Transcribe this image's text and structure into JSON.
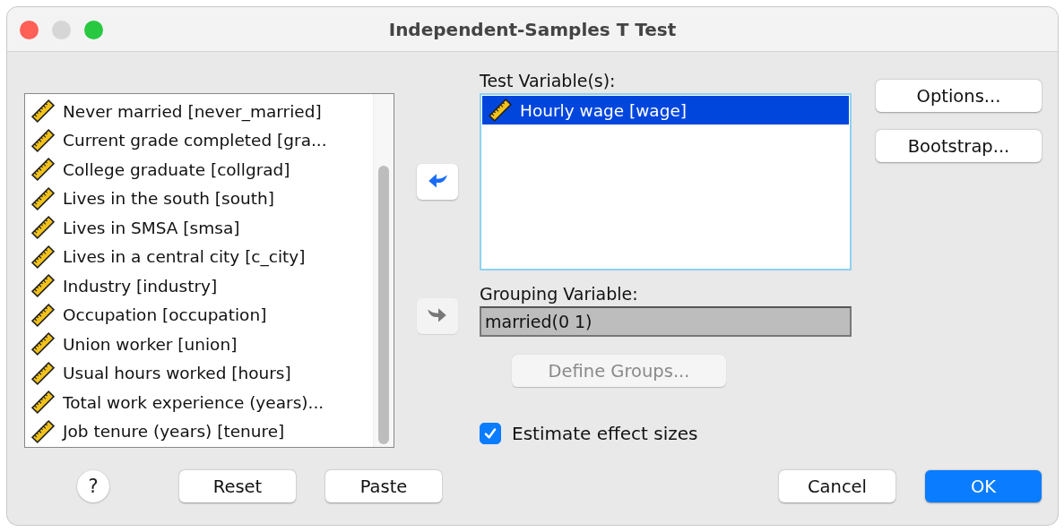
{
  "window": {
    "title": "Independent-Samples T Test"
  },
  "source_list": {
    "items": [
      {
        "label": "Never married [never_married]",
        "selected": false
      },
      {
        "label": "Current grade completed [gra...",
        "selected": false
      },
      {
        "label": "College graduate [collgrad]",
        "selected": false
      },
      {
        "label": "Lives in the south [south]",
        "selected": false
      },
      {
        "label": "Lives in SMSA [smsa]",
        "selected": false
      },
      {
        "label": "Lives in a central city [c_city]",
        "selected": false
      },
      {
        "label": "Industry [industry]",
        "selected": false
      },
      {
        "label": "Occupation [occupation]",
        "selected": false
      },
      {
        "label": "Union worker [union]",
        "selected": false
      },
      {
        "label": "Usual hours worked [hours]",
        "selected": false
      },
      {
        "label": "Total work experience (years)...",
        "selected": false
      },
      {
        "label": "Job tenure (years) [tenure]",
        "selected": false
      }
    ]
  },
  "move_buttons": [
    {
      "disabled": false
    },
    {
      "disabled": true
    }
  ],
  "test_variables": {
    "label": "Test Variable(s):",
    "items": [
      {
        "label": "Hourly wage [wage]",
        "selected": true
      }
    ]
  },
  "grouping_variable": {
    "label": "Grouping Variable:",
    "value": "married(0 1)"
  },
  "define_groups": {
    "label": "Define Groups...",
    "disabled": true
  },
  "estimate_effect_sizes": {
    "label": "Estimate effect sizes",
    "checked": true
  },
  "side_buttons": [
    "Options...",
    "Bootstrap..."
  ],
  "help": {
    "label": "?"
  },
  "bottom_buttons": [
    {
      "label": "Reset",
      "default": false
    },
    {
      "label": "Paste",
      "default": false
    },
    {
      "label": "Cancel",
      "default": false
    },
    {
      "label": "OK",
      "default": true
    }
  ]
}
